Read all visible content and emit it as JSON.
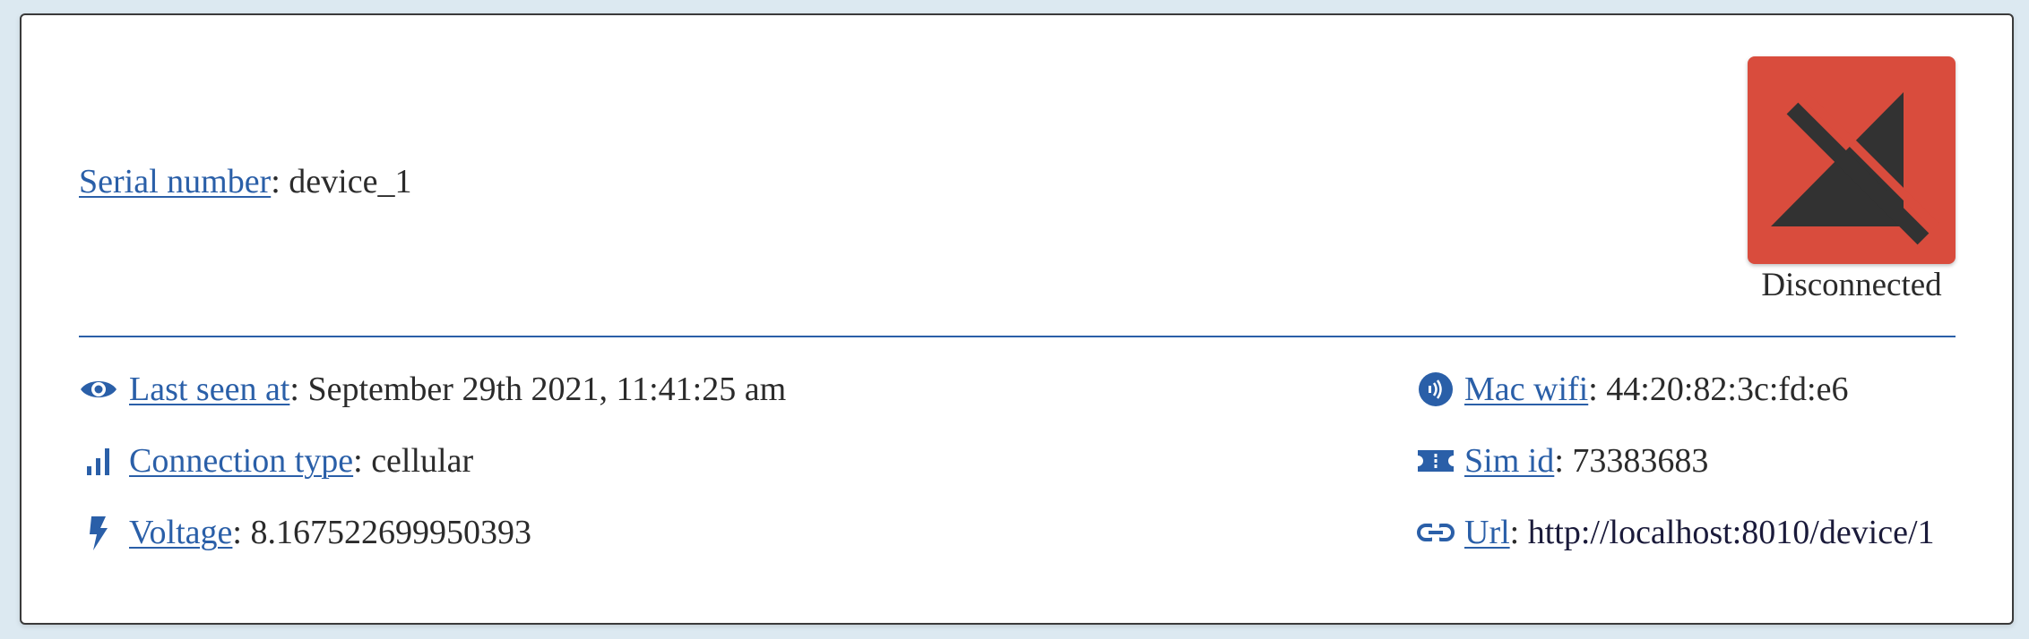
{
  "header": {
    "serial": {
      "label": "Serial number",
      "value": "device_1"
    },
    "status": {
      "label": "Disconnected",
      "icon": "signal-off-icon",
      "color": "#d94c3d"
    }
  },
  "details": {
    "left": [
      {
        "label": "Last seen at",
        "value": "September 29th 2021, 11:41:25 am",
        "icon": "eye-icon"
      },
      {
        "label": "Connection type",
        "value": "cellular",
        "icon": "signal-bars-icon"
      },
      {
        "label": "Voltage",
        "value": "8.167522699950393",
        "icon": "lightning-icon"
      }
    ],
    "right": [
      {
        "label": "Mac wifi",
        "value": "44:20:82:3c:fd:e6",
        "icon": "wifi-nfc-icon"
      },
      {
        "label": "Sim id",
        "value": "73383683",
        "icon": "sim-card-icon"
      },
      {
        "label": "Url",
        "value": "http://localhost:8010/device/1",
        "icon": "link-icon"
      }
    ]
  },
  "colors": {
    "accent": "#2a5fa8",
    "status_error": "#d94c3d",
    "background": "#dce9f1"
  }
}
